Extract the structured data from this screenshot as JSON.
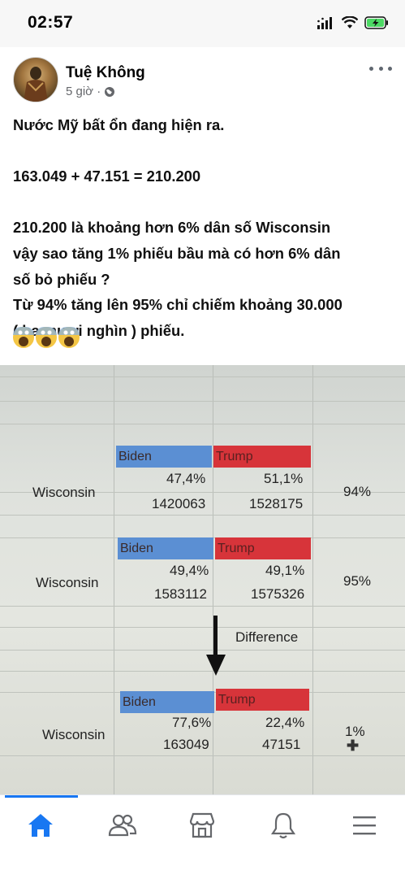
{
  "status_bar": {
    "time": "02:57"
  },
  "post": {
    "author": "Tuệ Không",
    "time": "5 giờ ·",
    "lines": [
      "Nước Mỹ bất ổn đang hiện ra.",
      "",
      "163.049 + 47.151 = 210.200",
      "",
      "210.200 là khoảng hơn 6% dân số Wisconsin",
      "vậy sao tăng 1% phiếu bầu mà có hơn 6% dân",
      "số bỏ phiếu ?",
      "Từ 94% tăng lên 95% chỉ chiếm khoảng 30.000",
      "( ba mươi nghìn ) phiếu.",
      ""
    ]
  },
  "photo": {
    "labels": {
      "biden": "Biden",
      "trump": "Trump",
      "state": "Wisconsin",
      "difference": "Difference"
    },
    "table1": {
      "biden_pct": "47,4%",
      "trump_pct": "51,1%",
      "biden_votes": "1420063",
      "trump_votes": "1528175",
      "reporting": "94%"
    },
    "table2": {
      "biden_pct": "49,4%",
      "trump_pct": "49,1%",
      "biden_votes": "1583112",
      "trump_votes": "1575326",
      "reporting": "95%"
    },
    "table3": {
      "biden_pct": "77,6%",
      "trump_pct": "22,4%",
      "biden_votes": "163049",
      "trump_votes": "47151",
      "reporting": "1%"
    }
  },
  "nav": {
    "items": [
      "home-icon",
      "friends-icon",
      "marketplace-icon",
      "notifications-icon",
      "menu-icon"
    ],
    "accent": "#1877f2"
  }
}
